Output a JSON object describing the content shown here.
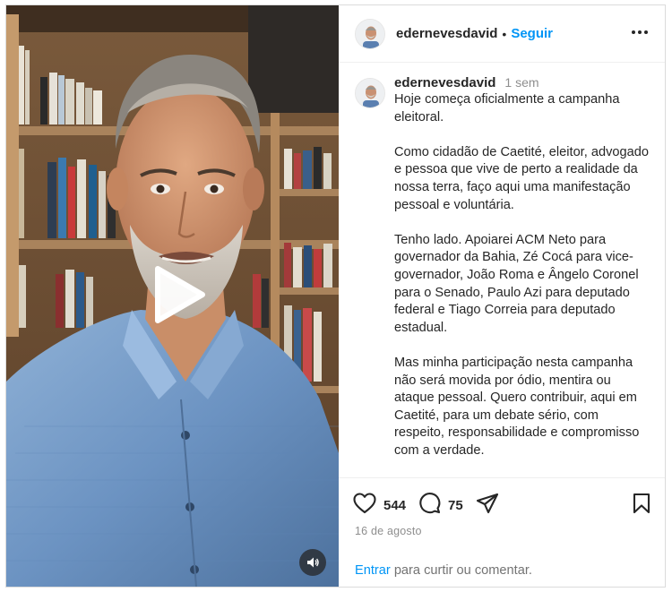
{
  "post": {
    "author": "edernevesdavid",
    "separator": "•",
    "follow_label": "Seguir",
    "time_ago": "1 sem",
    "caption_paragraphs": [
      "Hoje começa oficialmente a campanha eleitoral.",
      "Como cidadão de Caetité, eleitor, advogado e pessoa que vive de perto a realidade da nossa terra, faço aqui uma manifestação pessoal e voluntária.",
      "Tenho lado. Apoiarei ACM Neto para governador da Bahia, Zé Cocá para vice-governador, João Roma e Ângelo Coronel para o Senado, Paulo Azi para deputado federal e Tiago Correia para deputado estadual.",
      "Mas minha participação nesta campanha não será movida por ódio, mentira ou ataque pessoal. Quero contribuir, aqui em Caetité, para um debate sério, com respeito, responsabilidade e compromisso com a verdade."
    ],
    "likes": "544",
    "comments": "75",
    "date": "16 de agosto",
    "login_link": "Entrar",
    "login_text": "para curtir ou comentar."
  },
  "icons": {
    "more": "more-options-icon",
    "like": "heart-icon",
    "comment": "comment-icon",
    "share": "share-icon",
    "save": "bookmark-icon",
    "play": "play-icon",
    "sound": "speaker-icon"
  },
  "colors": {
    "accent": "#0095f6",
    "text": "#262626",
    "muted": "#8e8e8e",
    "border": "#dbdbdb"
  }
}
